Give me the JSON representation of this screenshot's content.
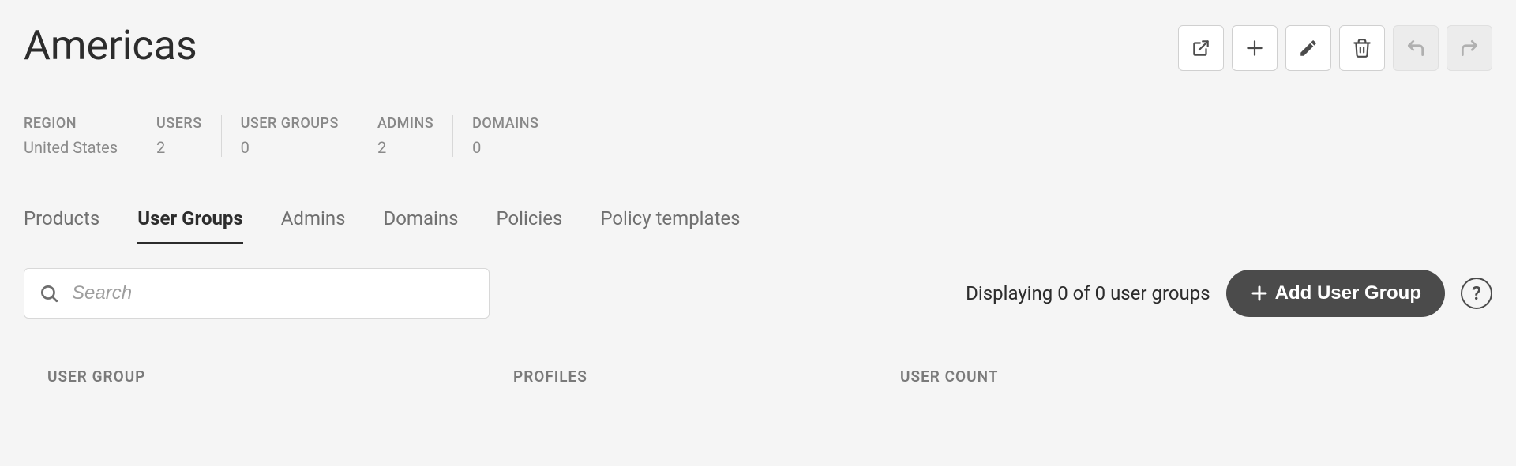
{
  "header": {
    "title": "Americas"
  },
  "actions": {
    "export": "export",
    "add": "add",
    "edit": "edit",
    "delete": "delete",
    "undo": "undo",
    "redo": "redo"
  },
  "stats": [
    {
      "label": "REGION",
      "value": "United States"
    },
    {
      "label": "USERS",
      "value": "2"
    },
    {
      "label": "USER GROUPS",
      "value": "0"
    },
    {
      "label": "ADMINS",
      "value": "2"
    },
    {
      "label": "DOMAINS",
      "value": "0"
    }
  ],
  "tabs": [
    {
      "label": "Products",
      "active": false
    },
    {
      "label": "User Groups",
      "active": true
    },
    {
      "label": "Admins",
      "active": false
    },
    {
      "label": "Domains",
      "active": false
    },
    {
      "label": "Policies",
      "active": false
    },
    {
      "label": "Policy templates",
      "active": false
    }
  ],
  "search": {
    "placeholder": "Search",
    "value": ""
  },
  "listing": {
    "display_text": "Displaying 0 of 0 user groups",
    "add_button_label": "Add User Group"
  },
  "table": {
    "columns": [
      "USER GROUP",
      "PROFILES",
      "USER COUNT"
    ],
    "rows": []
  },
  "help": {
    "label": "?"
  }
}
